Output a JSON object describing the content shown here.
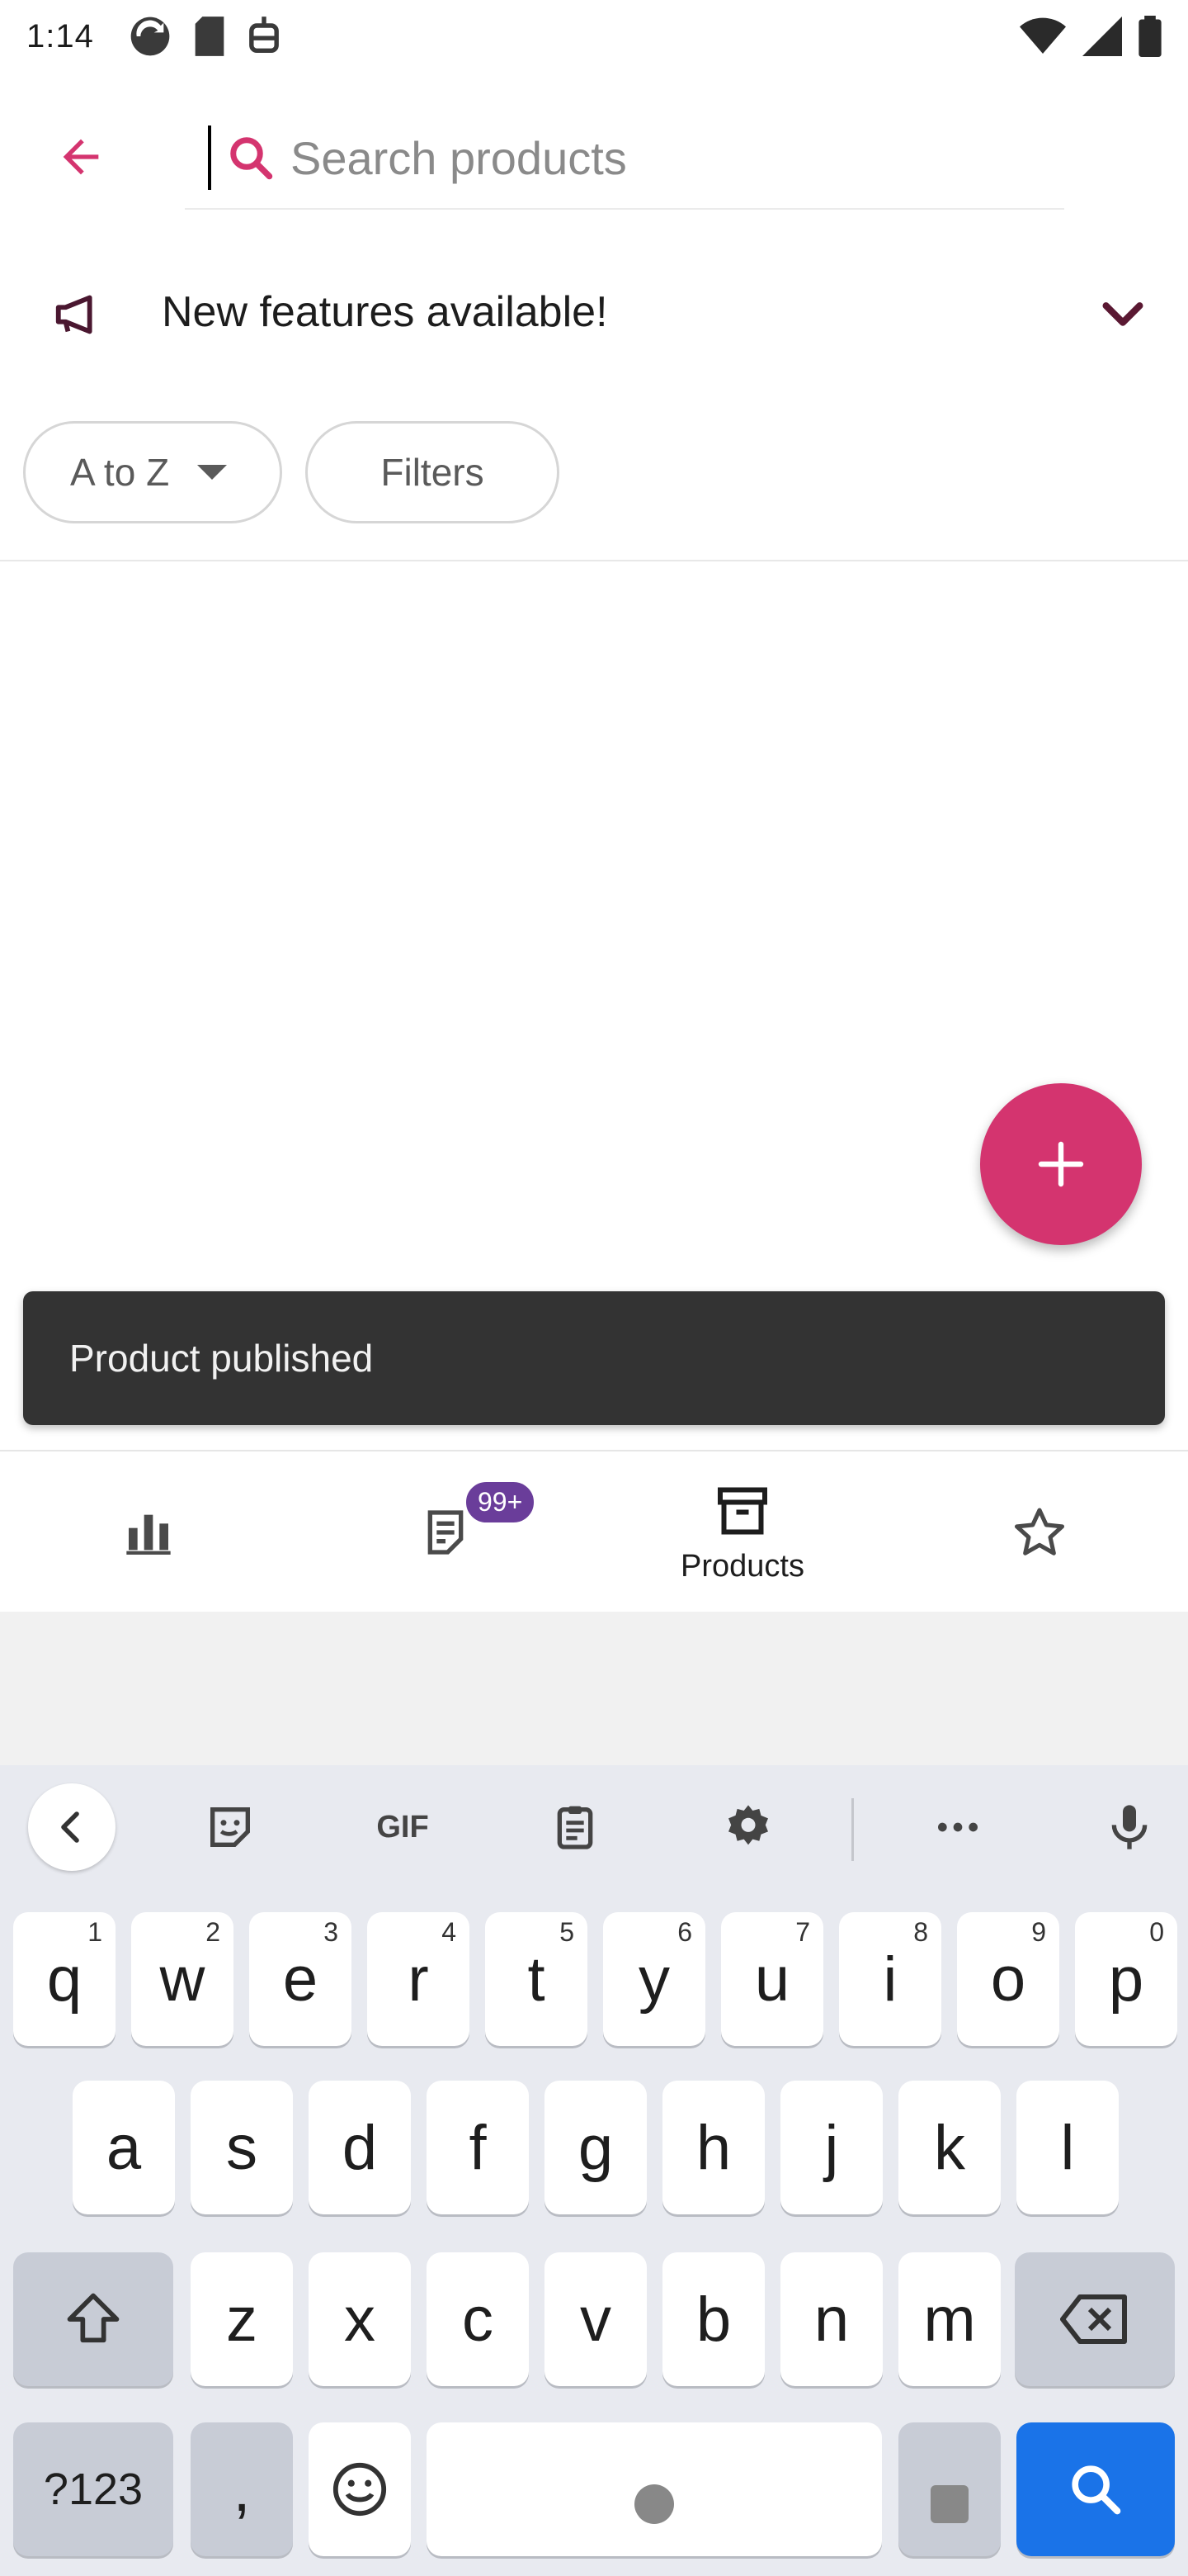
{
  "status_bar": {
    "time": "1:14"
  },
  "search": {
    "placeholder": "Search products"
  },
  "banner": {
    "text": "New features available!"
  },
  "filters": {
    "sort_label": "A to Z",
    "filters_label": "Filters"
  },
  "snackbar": {
    "message": "Product published"
  },
  "bottom_nav": {
    "items": [
      {
        "name": "stats",
        "icon": "bar-chart-icon",
        "label": ""
      },
      {
        "name": "orders",
        "icon": "orders-icon",
        "label": "",
        "badge": "99+"
      },
      {
        "name": "products",
        "icon": "archive-box-icon",
        "label": "Products",
        "selected": true
      },
      {
        "name": "reviews",
        "icon": "star-icon",
        "label": ""
      }
    ]
  },
  "keyboard": {
    "toolbar": {
      "gif_label": "GIF"
    },
    "row1": [
      {
        "key": "q",
        "num": "1"
      },
      {
        "key": "w",
        "num": "2"
      },
      {
        "key": "e",
        "num": "3"
      },
      {
        "key": "r",
        "num": "4"
      },
      {
        "key": "t",
        "num": "5"
      },
      {
        "key": "y",
        "num": "6"
      },
      {
        "key": "u",
        "num": "7"
      },
      {
        "key": "i",
        "num": "8"
      },
      {
        "key": "o",
        "num": "9"
      },
      {
        "key": "p",
        "num": "0"
      }
    ],
    "row2": [
      "a",
      "s",
      "d",
      "f",
      "g",
      "h",
      "j",
      "k",
      "l"
    ],
    "row3": [
      "z",
      "x",
      "c",
      "v",
      "b",
      "n",
      "m"
    ],
    "symbols_label": "?123",
    "comma_label": ","
  },
  "colors": {
    "accent": "#d4346f",
    "badge": "#6a3d9a",
    "keyboard_action": "#1a73e8",
    "snackbar": "#333333"
  }
}
